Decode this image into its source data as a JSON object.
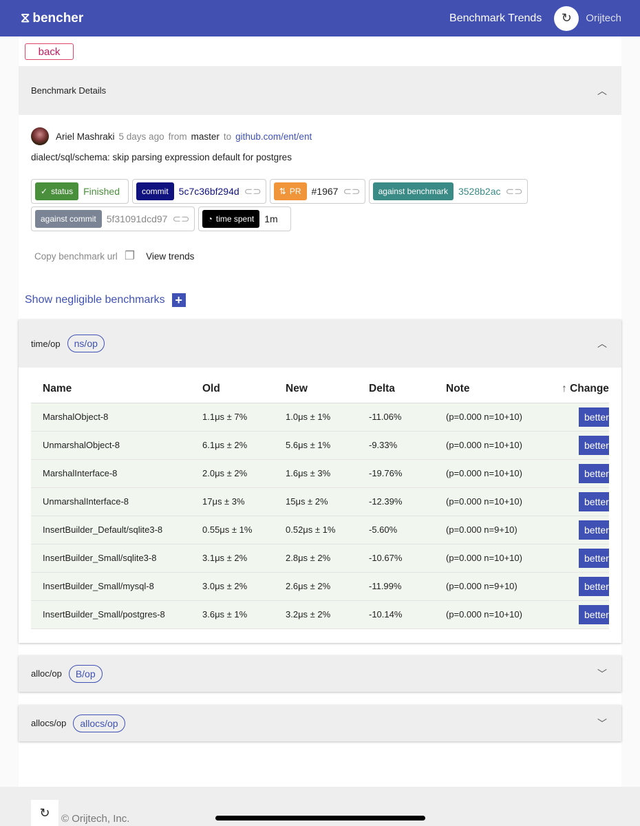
{
  "header": {
    "brand": "bencher",
    "trends_link": "Benchmark Trends",
    "org": "Orijtech"
  },
  "back_label": "back",
  "details": {
    "title": "Benchmark Details",
    "author": "Ariel Mashraki",
    "age": "5 days ago",
    "from_word": "from",
    "branch": "master",
    "to_word": "to",
    "repo": "github.com/ent/ent",
    "message": "dialect/sql/schema: skip parsing expression default for postgres",
    "chips": {
      "status_label": "status",
      "status_value": "Finished",
      "commit_label": "commit",
      "commit_value": "5c7c36bf294d",
      "pr_label": "PR",
      "pr_value": "#1967",
      "against_benchmark_label": "against benchmark",
      "against_benchmark_value": "3528b2ac",
      "against_commit_label": "against commit",
      "against_commit_value": "5f31091dcd97",
      "time_spent_label": "time spent",
      "time_spent_value": "1m"
    },
    "copy_url": "Copy benchmark url",
    "view_trends": "View trends"
  },
  "show_negligible": "Show negligible benchmarks",
  "sections": [
    {
      "title": "time/op",
      "unit": "ns/op",
      "expanded": true
    },
    {
      "title": "alloc/op",
      "unit": "B/op",
      "expanded": false
    },
    {
      "title": "allocs/op",
      "unit": "allocs/op",
      "expanded": false
    }
  ],
  "table": {
    "headers": [
      "Name",
      "Old",
      "New",
      "Delta",
      "Note",
      "Change"
    ],
    "rows": [
      [
        "MarshalObject-8",
        "1.1μs ± 7%",
        "1.0μs ± 1%",
        "-11.06%",
        "(p=0.000 n=10+10)",
        "better"
      ],
      [
        "UnmarshalObject-8",
        "6.1μs ± 2%",
        "5.6μs ± 1%",
        "-9.33%",
        "(p=0.000 n=10+10)",
        "better"
      ],
      [
        "MarshalInterface-8",
        "2.0μs ± 2%",
        "1.6μs ± 3%",
        "-19.76%",
        "(p=0.000 n=10+10)",
        "better"
      ],
      [
        "UnmarshalInterface-8",
        "17μs ± 3%",
        "15μs ± 2%",
        "-12.39%",
        "(p=0.000 n=10+10)",
        "better"
      ],
      [
        "InsertBuilder_Default/sqlite3-8",
        "0.55μs ± 1%",
        "0.52μs ± 1%",
        "-5.60%",
        "(p=0.000 n=9+10)",
        "better"
      ],
      [
        "InsertBuilder_Small/sqlite3-8",
        "3.1μs ± 2%",
        "2.8μs ± 2%",
        "-10.67%",
        "(p=0.000 n=10+10)",
        "better"
      ],
      [
        "InsertBuilder_Small/mysql-8",
        "3.0μs ± 2%",
        "2.6μs ± 2%",
        "-11.99%",
        "(p=0.000 n=9+10)",
        "better"
      ],
      [
        "InsertBuilder_Small/postgres-8",
        "3.6μs ± 1%",
        "3.2μs ± 2%",
        "-10.14%",
        "(p=0.000 n=10+10)",
        "better"
      ]
    ]
  },
  "footer": {
    "copyright": "© Orijtech, Inc."
  },
  "colors": {
    "header": "#4150b1",
    "status": "#4a8f3c",
    "commit": "#10127f",
    "pr": "#f0953a",
    "against_benchmark": "#3a8a86",
    "against_commit": "#7a8494",
    "time_spent": "#000000",
    "better": "#3f51b5"
  }
}
